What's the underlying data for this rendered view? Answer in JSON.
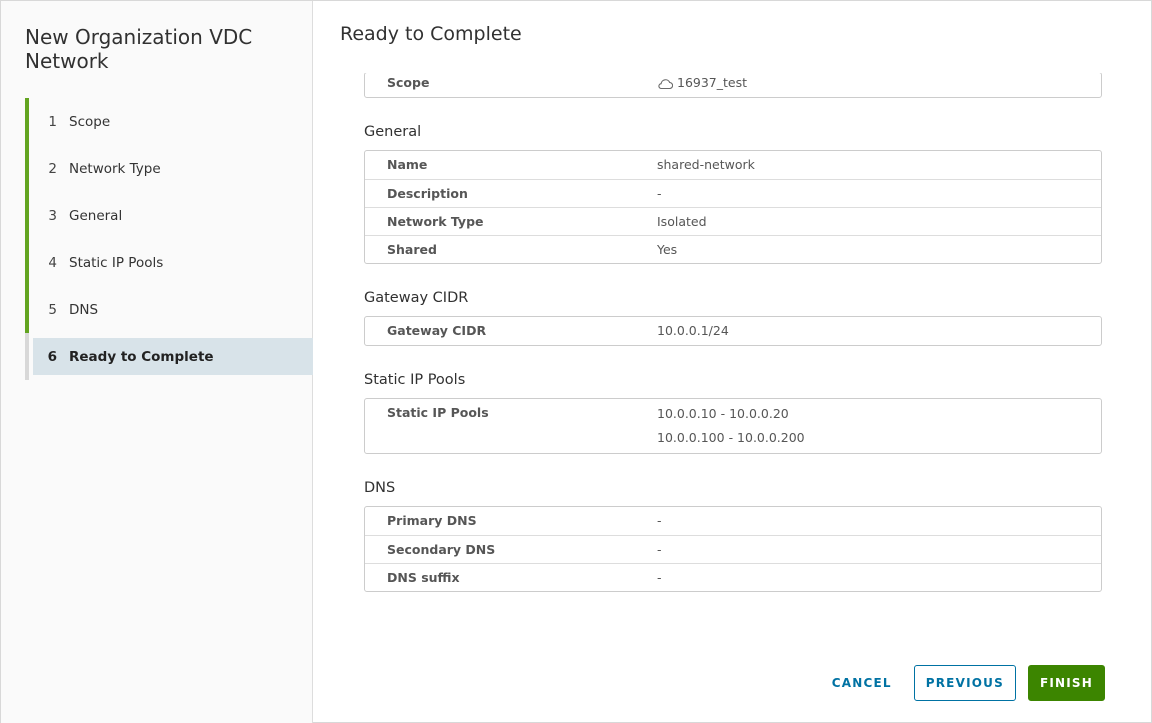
{
  "wizard": {
    "title": "New Organization VDC Network",
    "steps": [
      {
        "num": "1",
        "label": "Scope"
      },
      {
        "num": "2",
        "label": "Network Type"
      },
      {
        "num": "3",
        "label": "General"
      },
      {
        "num": "4",
        "label": "Static IP Pools"
      },
      {
        "num": "5",
        "label": "DNS"
      },
      {
        "num": "6",
        "label": "Ready to Complete"
      }
    ],
    "active_step": "6"
  },
  "page": {
    "title": "Ready to Complete"
  },
  "scope": {
    "key": "Scope",
    "value": "16937_test",
    "icon": "cloud-icon"
  },
  "general": {
    "title": "General",
    "rows": [
      {
        "key": "Name",
        "value": "shared-network"
      },
      {
        "key": "Description",
        "value": "-"
      },
      {
        "key": "Network Type",
        "value": "Isolated"
      },
      {
        "key": "Shared",
        "value": "Yes"
      }
    ]
  },
  "gateway": {
    "title": "Gateway CIDR",
    "rows": [
      {
        "key": "Gateway CIDR",
        "value": "10.0.0.1/24"
      }
    ]
  },
  "pools": {
    "title": "Static IP Pools",
    "key": "Static IP Pools",
    "values": [
      "10.0.0.10 - 10.0.0.20",
      "10.0.0.100 - 10.0.0.200"
    ]
  },
  "dns": {
    "title": "DNS",
    "rows": [
      {
        "key": "Primary DNS",
        "value": "-"
      },
      {
        "key": "Secondary DNS",
        "value": "-"
      },
      {
        "key": "DNS suffix",
        "value": "-"
      }
    ]
  },
  "footer": {
    "cancel_label": "CANCEL",
    "previous_label": "PREVIOUS",
    "finish_label": "FINISH"
  },
  "colors": {
    "accent": "#0072a3",
    "primary": "#3c8500",
    "step_done": "#62a420",
    "active_step_bg": "#d8e3e9"
  }
}
